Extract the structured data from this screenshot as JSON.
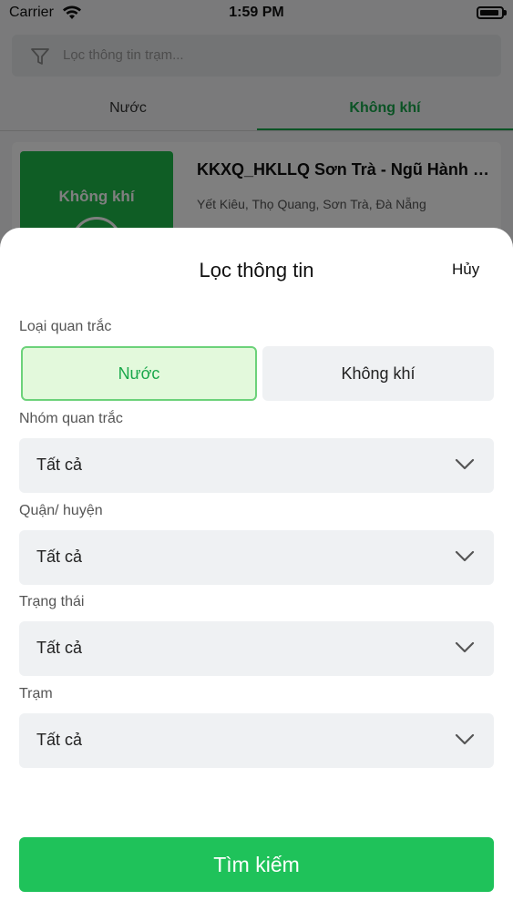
{
  "status_bar": {
    "carrier": "Carrier",
    "time": "1:59 PM"
  },
  "search": {
    "placeholder": "Lọc thông tin trạm..."
  },
  "tabs": [
    {
      "label": "Nước",
      "active": false
    },
    {
      "label": "Không khí",
      "active": true
    }
  ],
  "station_card": {
    "thumb_label": "Không khí",
    "title": "KKXQ_HKLLQ Sơn Trà - Ngũ Hành Sơn",
    "address": "Yết Kiêu, Thọ Quang, Sơn Trà, Đà Nẵng"
  },
  "sheet": {
    "title": "Lọc thông tin",
    "cancel_label": "Hủy",
    "monitor_type": {
      "label": "Loại quan trắc",
      "options": [
        "Nước",
        "Không khí"
      ],
      "selected": "Nước"
    },
    "filters": [
      {
        "label": "Nhóm quan trắc",
        "value": "Tất cả"
      },
      {
        "label": "Quận/ huyện",
        "value": "Tất cả"
      },
      {
        "label": "Trạng thái",
        "value": "Tất cả"
      },
      {
        "label": "Trạm",
        "value": "Tất cả"
      }
    ],
    "search_label": "Tìm kiếm"
  },
  "colors": {
    "accent": "#1fc25a",
    "tab_active": "#17a74a",
    "selected_bg": "#e3f9dc",
    "selected_border": "#6cd27a"
  }
}
